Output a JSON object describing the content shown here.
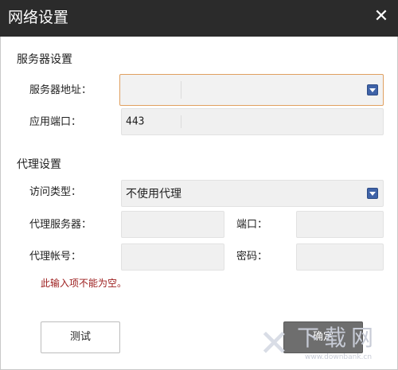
{
  "window": {
    "title": "网络设置",
    "close_glyph": "✕"
  },
  "server_section": {
    "heading": "服务器设置",
    "address_label": "服务器地址：",
    "address_value": "",
    "port_label": "应用端口：",
    "port_value": "443"
  },
  "proxy_section": {
    "heading": "代理设置",
    "access_type_label": "访问类型：",
    "access_type_value": "不使用代理",
    "proxy_server_label": "代理服务器：",
    "proxy_server_value": "",
    "proxy_port_label": "端口：",
    "proxy_port_value": "",
    "account_label": "代理帐号：",
    "account_value": "",
    "password_label": "密码：",
    "password_value": ""
  },
  "validation": {
    "error_message": "此输入项不能为空。"
  },
  "buttons": {
    "test_label": "测试",
    "ok_label": "确定"
  },
  "watermark": {
    "brand_text": "下载网",
    "url_text": "www.downbank.cn"
  },
  "colors": {
    "titlebar": "#2b2b2b",
    "focus_border": "#e0a060",
    "error_text": "#9b1a1a",
    "dropdown_arrow": "#3f63a8"
  },
  "icons": {
    "close": "close-icon",
    "dropdown": "chevron-down-icon",
    "watermark_logo": "x-logo-icon"
  }
}
